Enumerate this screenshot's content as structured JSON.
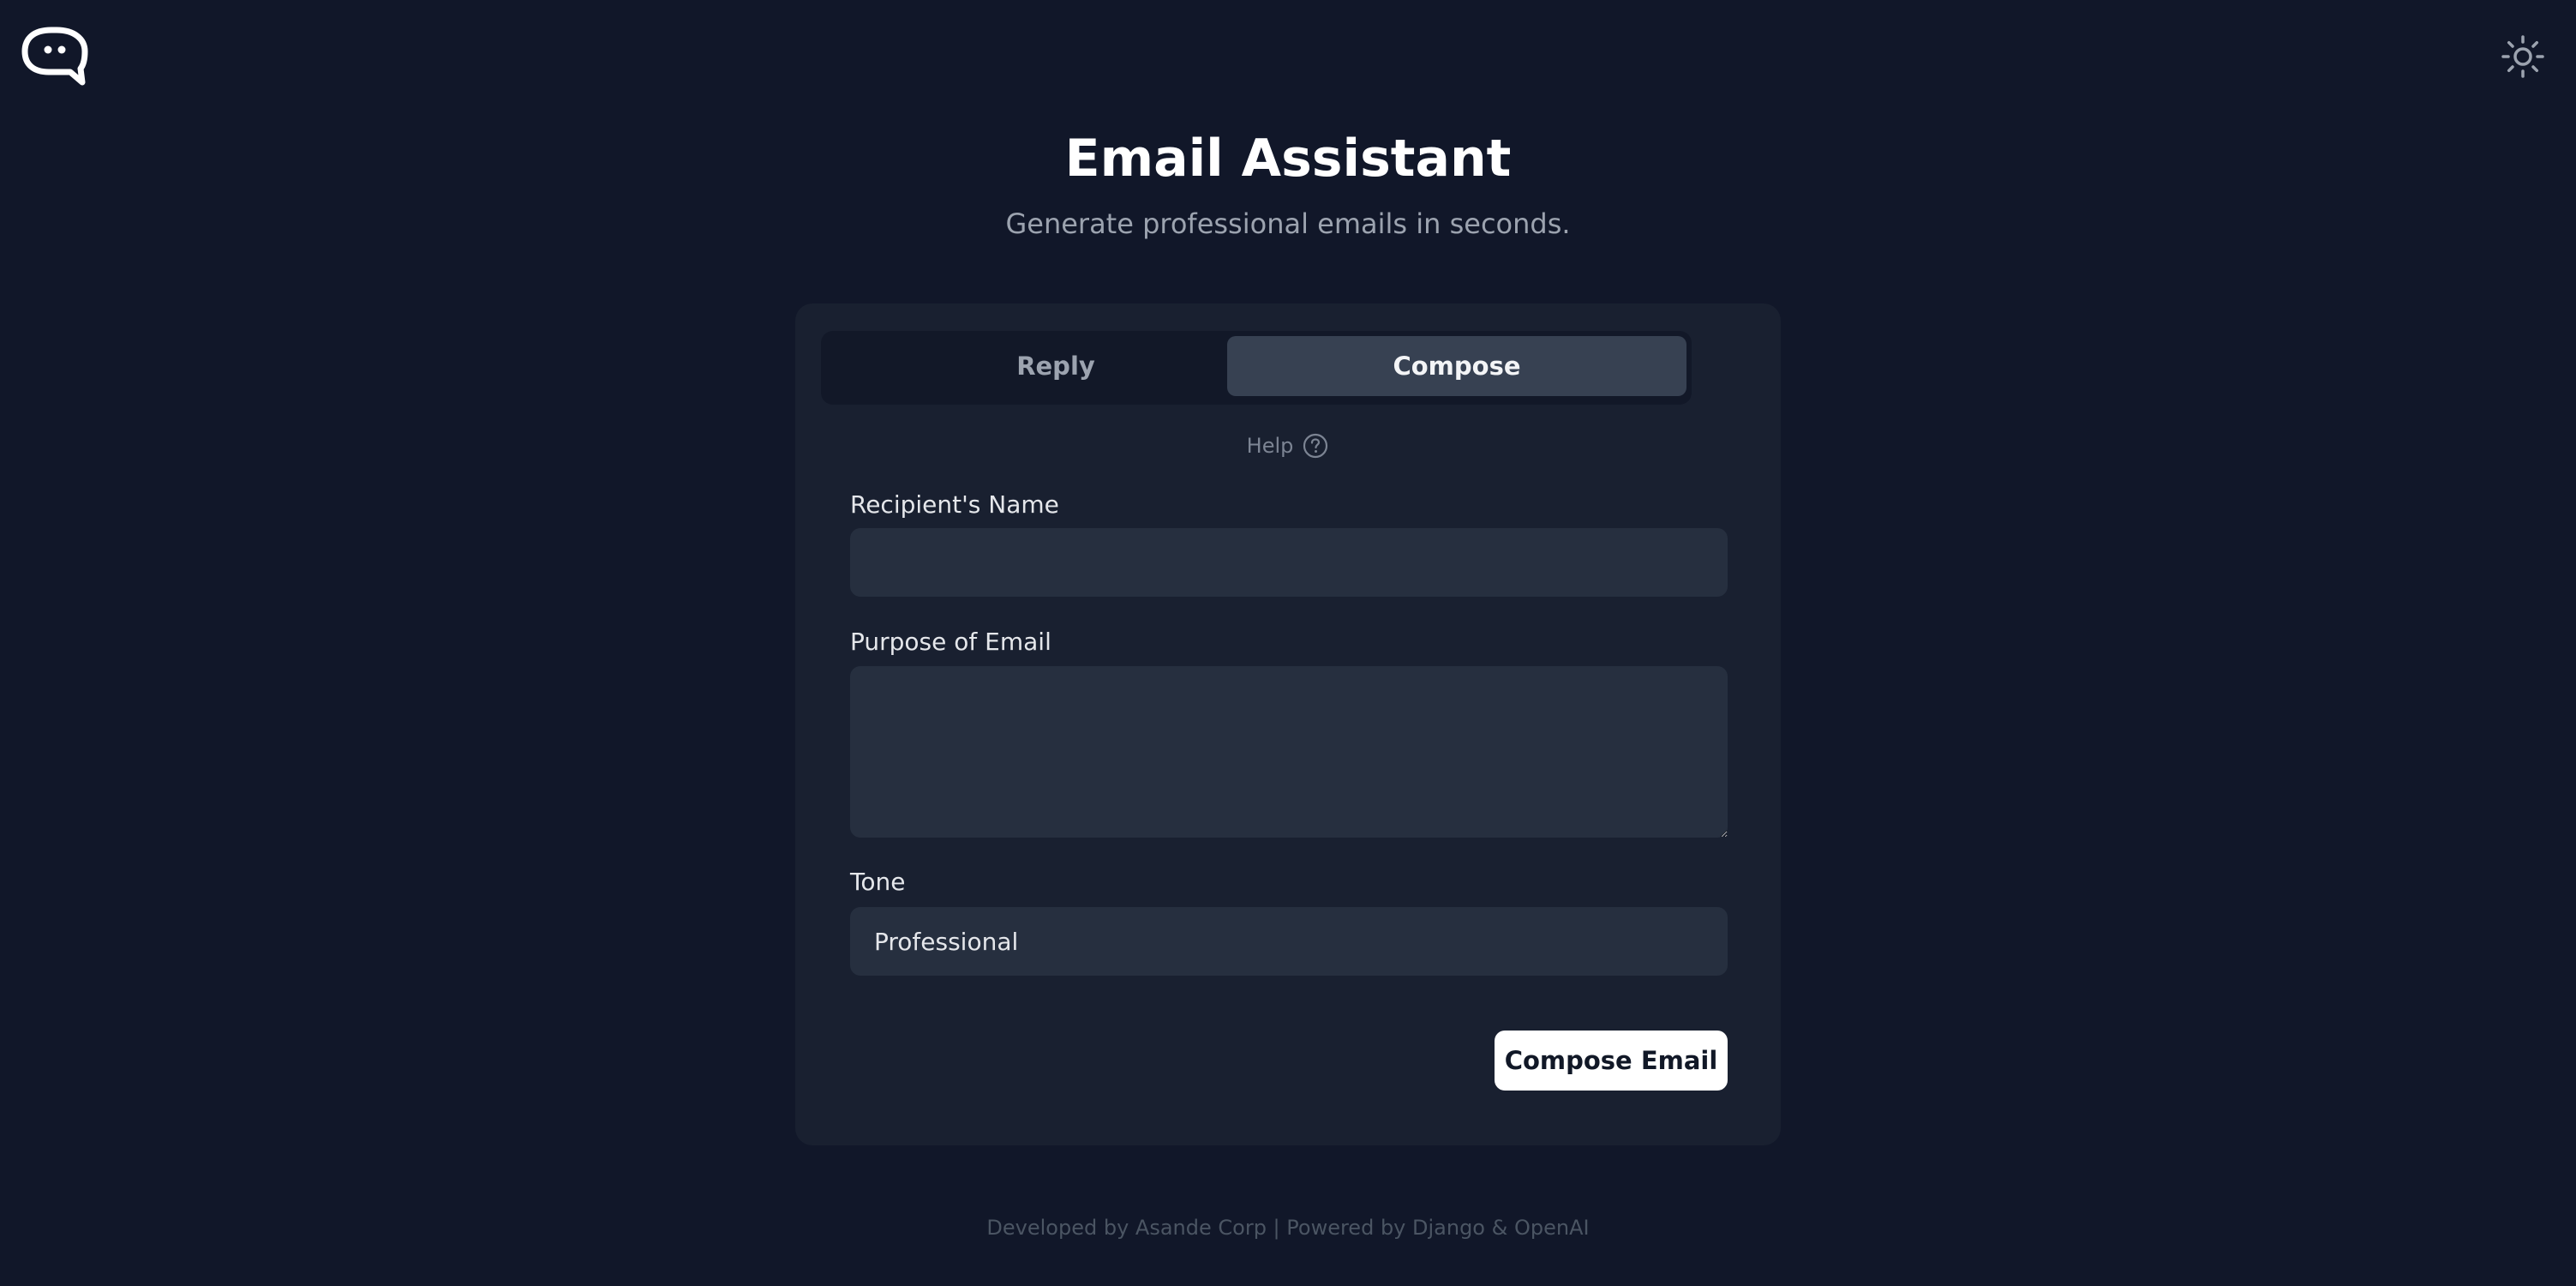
{
  "app": {
    "logo_icon": "chat-bubble-face-icon",
    "theme_icon": "sun-icon"
  },
  "header": {
    "title": "Email Assistant",
    "subtitle": "Generate professional emails in seconds."
  },
  "tabs": [
    {
      "label": "Reply",
      "active": false
    },
    {
      "label": "Compose",
      "active": true
    }
  ],
  "help": {
    "label": "Help",
    "icon": "question-circle-icon"
  },
  "form": {
    "recipient_label": "Recipient's Name",
    "recipient_value": "",
    "purpose_label": "Purpose of Email",
    "purpose_value": "",
    "tone_label": "Tone",
    "tone_value": "Professional",
    "submit_label": "Compose Email"
  },
  "footer": {
    "text": "Developed by Asande Corp | Powered by Django & OpenAI"
  },
  "colors": {
    "background": "#111729",
    "card": "#192030",
    "field": "#262f3f",
    "active_tab": "#374152",
    "button": "#ffffff"
  }
}
